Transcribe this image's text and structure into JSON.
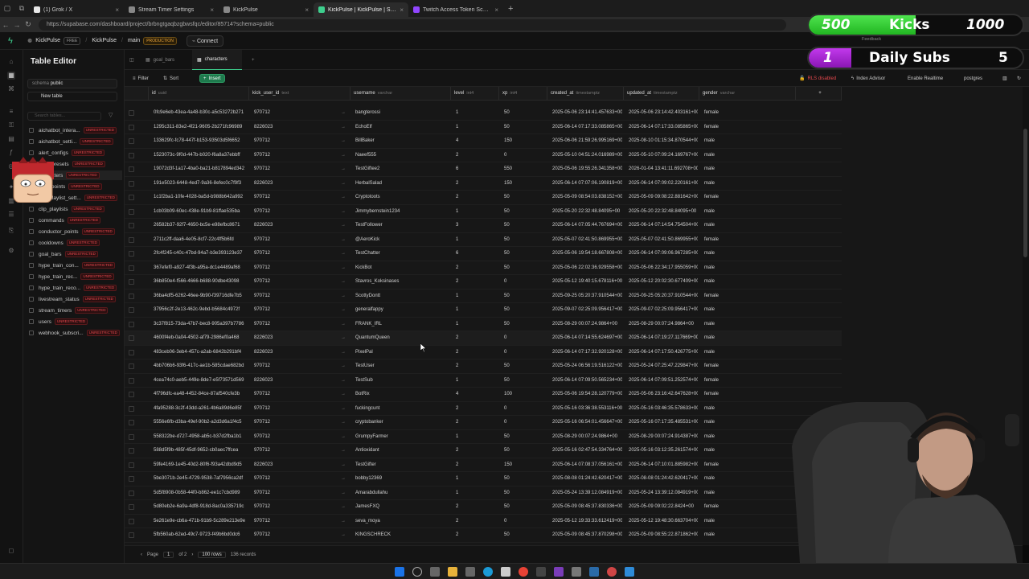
{
  "browser": {
    "tabs": [
      {
        "title": "(1) Grok / X",
        "fav": "#e8e8e8"
      },
      {
        "title": "Stream Timer Settings",
        "fav": "#888"
      },
      {
        "title": "KickPulse",
        "fav": "#888"
      },
      {
        "title": "KickPulse | KickPulse | Supabase",
        "fav": "#3ecf8e"
      },
      {
        "title": "Twitch Access Token Scopes | Twit",
        "fav": "#9146ff"
      }
    ],
    "active_tab": 3,
    "url": "https://supabase.com/dashboard/project/brbngtgaqbzgbwsfqc/editor/85714?schema=public"
  },
  "supabase": {
    "org": "KickPulse",
    "org_badge": "FREE",
    "project": "KickPulse",
    "branch": "main",
    "branch_badge": "PRODUCTION",
    "connect": "Connect",
    "feedback": "Feedback"
  },
  "sidebar": {
    "title": "Table Editor",
    "schema_label": "schema",
    "schema_value": "public",
    "new_table": "New table",
    "search_placeholder": "Search tables...",
    "unrestricted": "UNRESTRICTED",
    "tables": [
      "aichatbot_intera...",
      "aichatbot_setti...",
      "alert_configs",
      "alert_presets",
      "characters",
      "chat_points",
      "clip_playlist_sett...",
      "clip_playlists",
      "commands",
      "conductor_points",
      "cooldowns",
      "goal_bars",
      "hype_train_con...",
      "hype_train_rec...",
      "hype_train_reco...",
      "livestream_status",
      "stream_timers",
      "users",
      "webhook_subscri..."
    ]
  },
  "editor": {
    "tabs": [
      "goal_bars",
      "characters"
    ],
    "toolbar": {
      "filter": "Filter",
      "sort": "Sort",
      "insert": "Insert",
      "rls": "RLS disabled",
      "index_advisor": "Index Advisor",
      "realtime": "Enable Realtime",
      "role": "postgres"
    },
    "columns": [
      {
        "name": "id",
        "type": "uuid"
      },
      {
        "name": "kick_user_id",
        "type": "text"
      },
      {
        "name": "username",
        "type": "varchar"
      },
      {
        "name": "level",
        "type": "int4"
      },
      {
        "name": "xp",
        "type": "int4"
      },
      {
        "name": "created_at",
        "type": "timestamptz"
      },
      {
        "name": "updated_at",
        "type": "timestamptz"
      },
      {
        "name": "gender",
        "type": "varchar"
      }
    ],
    "rows": [
      [
        "0fc9e6eb-43ea-4a48-b30c-a5c53272b271",
        "970712",
        "bangterossi",
        "1",
        "50",
        "2025-05-06 23:14:41.457633+00",
        "2025-05-06 23:14:42.403161+00",
        "female"
      ],
      [
        "1295c311-83e2-4f21-9605-2b271fc96989",
        "8226023",
        "EchoElf",
        "1",
        "50",
        "2025-06-14 07:17:33.085865+00",
        "2025-06-14 07:17:33.085865+00",
        "female"
      ],
      [
        "133629fc-fc78-447f-b153-93503d5f6652",
        "970712",
        "BillBaker",
        "4",
        "150",
        "2025-06-06 21:59:26.995169+00",
        "2025-08-10 01:15:34.870544+00",
        "male"
      ],
      [
        "1523073c-9f0d-447b-b020-f6a8a37ebbff",
        "970712",
        "Naeef555",
        "2",
        "0",
        "2025-05-10 04:51:24.016989+00",
        "2025-05-10 07:09:24.169767+00",
        "male"
      ],
      [
        "19072d3f-1a17-4ba0-ba21-b817894ed342",
        "970712",
        "TestGiftee2",
        "6",
        "550",
        "2025-05-06 19:55:26.341358+00",
        "2026-01-04 13:41:11.692708+00",
        "male"
      ],
      [
        "191e5023-6448-4ed7-9a36-8efec0c7f9f3",
        "8226023",
        "HerbalSalad",
        "2",
        "150",
        "2025-06-14 07:07:06.190819+00",
        "2025-06-14 07:09:02.220161+00",
        "male"
      ],
      [
        "1c1f2ba1-10fe-4028-ba5d-b988b642a992",
        "970712",
        "Cryptotoots",
        "2",
        "50",
        "2025-05-09 08:54:03.838152+00",
        "2025-05-09 09:08:22.881642+00",
        "female"
      ],
      [
        "1cb03b09-60ec-438e-91b9-81ffae535ba",
        "970712",
        "Jimmybernstein1234",
        "1",
        "50",
        "2025-05-20 22:32:48.84095+00",
        "2025-05-20 22:32:48.84095+00",
        "male"
      ],
      [
        "26582b37-92f7-4650-bc5e-e98efbc8671",
        "8226023",
        "TestFollower",
        "3",
        "50",
        "2025-06-14 07:05:44.767694+00",
        "2025-06-14 07:14:54.754504+00",
        "male"
      ],
      [
        "2711c2ff-daa6-4e05-8cf7-22c4ff5b6fd",
        "970712",
        "@AeroKick",
        "1",
        "50",
        "2025-05-07 02:41:50.869955+00",
        "2025-05-07 02:41:50.869955+00",
        "female"
      ],
      [
        "2fc4f245-c40c-47bd-94a7-b3e393123e37",
        "970712",
        "TestChatter",
        "6",
        "50",
        "2025-05-06 19:54:18.667808+00",
        "2025-06-14 07:09:06.967285+00",
        "male"
      ],
      [
        "367efef0-a927-4f3b-a95a-dc1e4489af68",
        "970712",
        "KickBot",
        "2",
        "50",
        "2025-05-06 22:02:36.929558+00",
        "2025-05-06 22:34:17.955059+00",
        "male"
      ],
      [
        "36b850e4-f566-4666-b688-90dbe43098",
        "970712",
        "Stavros_Koksinases",
        "2",
        "0",
        "2025-05-12 19:40:15.678116+00",
        "2025-05-12 20:02:30.677409+00",
        "male"
      ],
      [
        "36ba4df5-6262-46ee-9b90-f39716dfe7b5",
        "970712",
        "ScottyDontt",
        "1",
        "50",
        "2025-09-25 05:20:37.910544+00",
        "2025-09-25 05:20:37.910544+00",
        "female"
      ],
      [
        "37956c2f-2e13-462c-9ebd-b5684c4972f",
        "970712",
        "generalfappy",
        "1",
        "50",
        "2025-09-07 02:25:09.956417+00",
        "2025-09-07 02:25:09.956417+00",
        "male"
      ],
      [
        "3c37f815-73da-47b7-bec8-905a397b7786",
        "970712",
        "FRANK_IRL",
        "1",
        "50",
        "2025-08-29 00:07:24.9864+00",
        "2025-08-29 00:07:24.9864+00",
        "male"
      ],
      [
        "4600f4eb-0a04-4502-af79-2986ef0a468",
        "8226023",
        "QuantumQueen",
        "2",
        "0",
        "2025-06-14 07:14:55.624697+00",
        "2025-06-14 07:19:27.117669+00",
        "male"
      ],
      [
        "483ceb06-3eb4-457c-a2ab-6842b291bf4",
        "8226023",
        "PixelPal",
        "2",
        "0",
        "2025-06-14 07:17:32.920128+00",
        "2025-06-14 07:17:50.426775+00",
        "male"
      ],
      [
        "4bb706b6-93f6-417c-ae1b-585cdae682bd",
        "970712",
        "TestUser",
        "2",
        "50",
        "2025-05-24 06:56:19.516122+00",
        "2025-05-24 07:25:47.229847+00",
        "female"
      ],
      [
        "4cea74c0-aeb5-449e-8de7-e5f73571d569",
        "8226023",
        "TestSub",
        "1",
        "50",
        "2025-06-14 07:09:50.565234+00",
        "2025-06-14 07:09:51.252574+00",
        "female"
      ],
      [
        "4f796dfc-ea48-4452-84ce-87af540cfe3b",
        "970712",
        "BotRix",
        "4",
        "100",
        "2025-05-06 19:54:28.120779+00",
        "2025-05-06 23:16:42.647628+00",
        "female"
      ],
      [
        "4fa95288-3c2f-43dd-a261-4b6a89d6e85f",
        "970712",
        "fuckingcunt",
        "2",
        "0",
        "2025-05-16 03:36:38.553116+00",
        "2025-05-16 03:46:35.578633+00",
        "male"
      ],
      [
        "5556e6fb-d3ba-49ef-90b2-a2d3d6a1f4c5",
        "970712",
        "cryptobanker",
        "2",
        "0",
        "2025-05-16 06:54:01.456647+00",
        "2025-05-16 07:17:35.485531+00",
        "male"
      ],
      [
        "558322be-d727-4958-ab5c-b37d2fba1b1",
        "970712",
        "GrumpyFarmer",
        "1",
        "50",
        "2025-08-29 00:07:24.9864+00",
        "2025-08-29 00:07:24.914387+00",
        "male"
      ],
      [
        "588d5f9b-485f-45df-9652-cb0aec7ffcea",
        "970712",
        "Antioxidant",
        "2",
        "50",
        "2025-05-16 02:47:54.334764+00",
        "2025-05-16 03:12:35.261574+00",
        "male"
      ],
      [
        "59fe4169-1e45-40d2-80f6-f93a42dbd9d5",
        "8226023",
        "TestGifter",
        "2",
        "150",
        "2025-06-14 07:08:37.056161+00",
        "2025-06-14 07:10:01.885982+00",
        "female"
      ],
      [
        "5be3071b-2e45-4729-9538-7af7956ca2df",
        "970712",
        "bobby12369",
        "1",
        "50",
        "2025-08-08 01:24:42.620417+00",
        "2025-08-08 01:24:42.620417+00",
        "male"
      ],
      [
        "5d5f8908-0b58-44f0-b862-ee1c7cbd989",
        "970712",
        "Amarabdullahu",
        "1",
        "50",
        "2025-05-24 13:39:12.084919+00",
        "2025-05-24 13:39:12.084919+00",
        "male"
      ],
      [
        "5d80eb2e-6a9a-4df8-918d-8ac0a335719c",
        "970712",
        "JamesFXQ",
        "2",
        "50",
        "2025-05-09 08:45:37.830336+00",
        "2025-05-09 09:02:22.8424+00",
        "female"
      ],
      [
        "5e261e9e-cb6a-471b-91b9-5c289e213e9e",
        "970712",
        "seva_moya",
        "2",
        "0",
        "2025-05-12 19:33:33.612419+00",
        "2025-05-12 19:48:30.663704+00",
        "male"
      ],
      [
        "5fb560ab-62ed-49c7-9723-f49b6bd0dc6",
        "970712",
        "KINGSCHRECK",
        "2",
        "50",
        "2025-05-09 08:45:37.870298+00",
        "2025-05-09 08:55:22.871862+00",
        "male"
      ]
    ],
    "pager": {
      "page_label": "Page",
      "page": "1",
      "of": "of 2",
      "rows": "100 rows",
      "records": "136 records"
    }
  },
  "overlay": {
    "kicks_current": "500",
    "kicks_label": "Kicks",
    "kicks_goal": "1000",
    "kicks_progress": 0.5,
    "subs_current": "1",
    "subs_label": "Daily Subs",
    "subs_goal": "5",
    "subs_progress": 0.2
  },
  "colors": {
    "accent": "#3ecf8e",
    "danger": "#e5484d",
    "kicks_bar": "#33cc33",
    "subs_bar": "#a526d6"
  }
}
